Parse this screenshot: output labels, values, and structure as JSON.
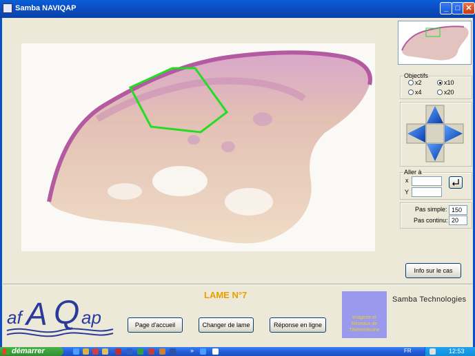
{
  "window": {
    "title": "Samba NAVIQAP",
    "min_label": "_",
    "max_label": "□",
    "close_label": "✕"
  },
  "objectives": {
    "label": "Objectifs",
    "options": [
      {
        "label": "x2",
        "selected": false
      },
      {
        "label": "x10",
        "selected": true
      },
      {
        "label": "x4",
        "selected": false
      },
      {
        "label": "x20",
        "selected": false
      }
    ]
  },
  "goto": {
    "label": "Aller à",
    "x_label": "x",
    "y_label": "Y",
    "x_value": "",
    "y_value": ""
  },
  "steps": {
    "simple_label": "Pas simple:",
    "simple_value": "150",
    "continuous_label": "Pas continu:",
    "continuous_value": "20"
  },
  "info_button": "Info sur le cas",
  "lame_title": "LAME N°7",
  "buttons": {
    "home": "Page d'accueil",
    "change": "Changer de lame",
    "answer": "Réponse en ligne"
  },
  "logo_text": "AFAQAP",
  "promo_text": "Imagerie et Réseaux de Télémédecine",
  "company": "Samba Technologies",
  "taskbar": {
    "start": "démarrer",
    "clock": "12:53",
    "lang": "FR"
  },
  "colors": {
    "accent_orange": "#e8a000",
    "selection_green": "#22dd22",
    "logo_blue": "#2a3a9a",
    "promo_purple": "#9999ee",
    "titlebar_blue": "#0b4fc4"
  }
}
